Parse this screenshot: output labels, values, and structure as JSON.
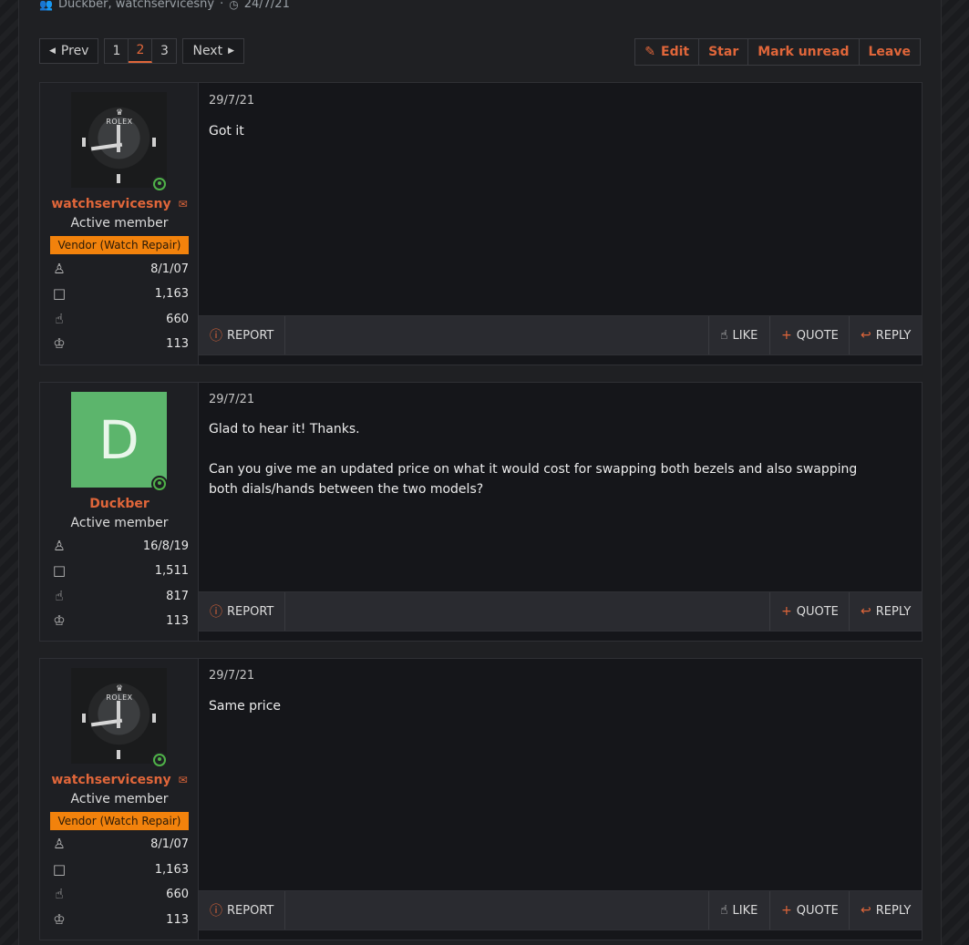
{
  "meta": {
    "participants": "Duckber, watchservicesny",
    "date": "24/7/21"
  },
  "pagination": {
    "prev": "Prev",
    "pages": [
      "1",
      "2",
      "3"
    ],
    "next": "Next"
  },
  "thread_actions": {
    "edit": "Edit",
    "star": "Star",
    "mark_unread": "Mark unread",
    "leave": "Leave"
  },
  "colors": {
    "accent": "#e0663a",
    "online": "#4fb248",
    "vendor_badge": "#f2820c",
    "avatar_green": "#5cb56c"
  },
  "posts": [
    {
      "username": "watchservicesny",
      "title": "Active member",
      "banner": "Vendor (Watch Repair)",
      "avatar_letter": "",
      "avatar_text": {
        "crown": "♛",
        "brand": "ROLEX"
      },
      "stats": {
        "joined": "8/1/07",
        "messages": "1,163",
        "reactions": "660",
        "points": "113"
      },
      "date": "29/7/21",
      "text": "Got it",
      "actions": {
        "report": "REPORT",
        "like": "LIKE",
        "quote": "QUOTE",
        "reply": "REPLY"
      }
    },
    {
      "username": "Duckber",
      "title": "Active member",
      "avatar_letter": "D",
      "stats": {
        "joined": "16/8/19",
        "messages": "1,511",
        "reactions": "817",
        "points": "113"
      },
      "date": "29/7/21",
      "text": "Glad to hear it! Thanks.\n\nCan you give me an updated price on what it would cost for swapping both bezels and also swapping both dials/hands between the two models?",
      "actions": {
        "report": "REPORT",
        "quote": "QUOTE",
        "reply": "REPLY"
      }
    },
    {
      "username": "watchservicesny",
      "title": "Active member",
      "banner": "Vendor (Watch Repair)",
      "avatar_letter": "",
      "avatar_text": {
        "crown": "♛",
        "brand": "ROLEX"
      },
      "stats": {
        "joined": "8/1/07",
        "messages": "1,163",
        "reactions": "660",
        "points": "113"
      },
      "date": "29/7/21",
      "text": "Same price",
      "actions": {
        "report": "REPORT",
        "like": "LIKE",
        "quote": "QUOTE",
        "reply": "REPLY"
      }
    }
  ]
}
